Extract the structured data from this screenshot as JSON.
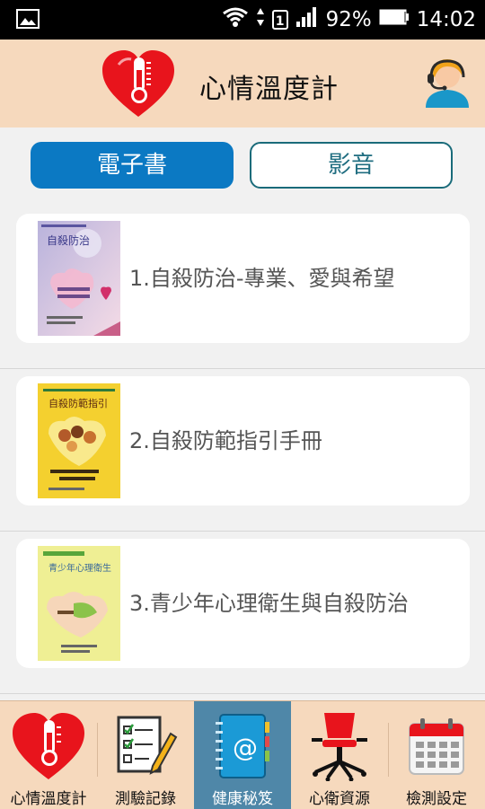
{
  "status_bar": {
    "battery_percent": "92%",
    "time": "14:02",
    "sim_label": "1",
    "icons": [
      "gallery-icon",
      "wifi-icon",
      "data-arrows-icon",
      "signal-icon",
      "battery-icon"
    ]
  },
  "header": {
    "title": "心情溫度計",
    "left_icon": "heart-thermometer-icon",
    "right_icon": "customer-support-icon"
  },
  "tabs": [
    {
      "label": "電子書",
      "active": true
    },
    {
      "label": "影音",
      "active": false
    }
  ],
  "books": [
    {
      "label": "1.自殺防治-專業、愛與希望",
      "cover_title": "自殺防治",
      "cover_colors": [
        "#cfc6e6",
        "#f1d9e6"
      ]
    },
    {
      "label": "2.自殺防範指引手冊",
      "cover_title": "自殺防範指引",
      "cover_colors": [
        "#f3cf2d",
        "#f7e37a"
      ]
    },
    {
      "label": "3.青少年心理衛生與自殺防治",
      "cover_title": "青少年心理衛生",
      "cover_colors": [
        "#ecec88",
        "#f5f0b8"
      ]
    }
  ],
  "bottom_nav": [
    {
      "label": "心情溫度計",
      "icon": "heart-thermometer-icon",
      "active": false
    },
    {
      "label": "測驗記錄",
      "icon": "checklist-pencil-icon",
      "active": false
    },
    {
      "label": "健康秘笈",
      "icon": "address-book-icon",
      "active": true
    },
    {
      "label": "心衛資源",
      "icon": "office-chair-icon",
      "active": false
    },
    {
      "label": "檢測設定",
      "icon": "calendar-icon",
      "active": false
    }
  ],
  "colors": {
    "header_bg": "#f6d9bd",
    "tab_active": "#0b79c3",
    "tab_border": "#1a6b7a",
    "nav_active": "#4f87a8"
  }
}
